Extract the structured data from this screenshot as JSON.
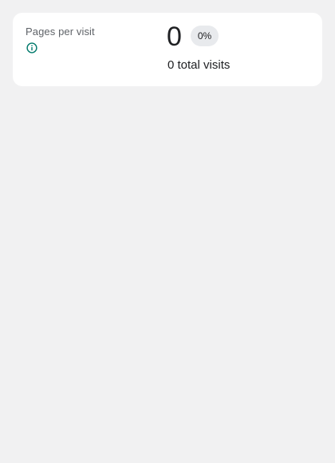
{
  "card": {
    "label": "Pages per visit",
    "info_icon": "info-icon",
    "value": "0",
    "change_badge": "0%",
    "total_visits": "0 total visits"
  },
  "colors": {
    "background": "#f1f1f2",
    "card": "#ffffff",
    "info_icon": "#00796b",
    "badge_bg": "#e8eaed",
    "label_text": "#5f6368"
  }
}
